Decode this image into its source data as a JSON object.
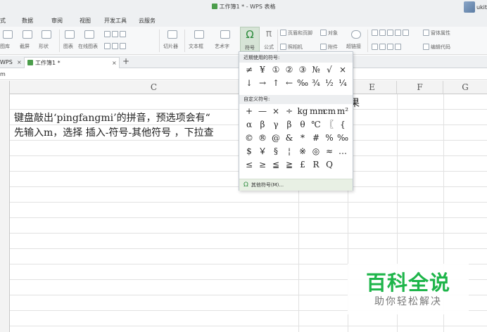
{
  "window": {
    "title": "工作簿1 * - WPS 表格",
    "user": "ukit"
  },
  "menu_tabs": [
    "式",
    "数据",
    "审阅",
    "视图",
    "开发工具",
    "云服务"
  ],
  "ribbon": {
    "items": [
      "图库",
      "截屏",
      "形状",
      "图表",
      "在线图表",
      "切片器",
      "文本框",
      "艺术字",
      "符号",
      "公式",
      "页眉和页脚",
      "对象",
      "照相机",
      "附件",
      "超链接",
      "窗体属性",
      "编辑代码"
    ]
  },
  "doc_tabs": {
    "first": "WPS",
    "active": "工作簿1 *",
    "add": "+"
  },
  "formula_bar": {
    "cell_ref": "m"
  },
  "columns": [
    "C",
    "E",
    "F",
    "G"
  ],
  "cells": {
    "line1": "键盘敲出‘pingfangmi’的拼音，预选项会有“",
    "line2": "先输入m，选择 插入-符号-其他符号 ，下拉查",
    "right_fragment": "果"
  },
  "symbol_dropdown": {
    "recent_header": "近期使用的符号:",
    "recent": [
      [
        "≠",
        "¥",
        "①",
        "②",
        "③",
        "№",
        "√",
        "×"
      ],
      [
        "↓",
        "→",
        "↑",
        "←",
        "‰",
        "¾",
        "½",
        "¼"
      ]
    ],
    "custom_header": "自定义符号:",
    "custom": [
      [
        "+",
        "—",
        "×",
        "÷",
        "kg",
        "mm",
        "cm",
        "m²"
      ],
      [
        "α",
        "β",
        "γ",
        "β",
        "θ",
        "℃",
        "〖",
        "{"
      ],
      [
        "©",
        "®",
        "@",
        "&",
        "*",
        "#",
        "%",
        "‰"
      ],
      [
        "$",
        "￥",
        "§",
        "¦",
        "※",
        "◎",
        "≈",
        "…"
      ],
      [
        "≤",
        "≥",
        "≦",
        "≧",
        "£",
        "R",
        "Q"
      ]
    ],
    "footer": "其他符号(M)..."
  },
  "watermark": {
    "title": "百科全说",
    "subtitle": "助你轻松解决"
  },
  "colors": {
    "accent_green": "#2a8a3a",
    "watermark_green": "#1eb54a",
    "symbol_button_bg": "#d6e4d6"
  }
}
